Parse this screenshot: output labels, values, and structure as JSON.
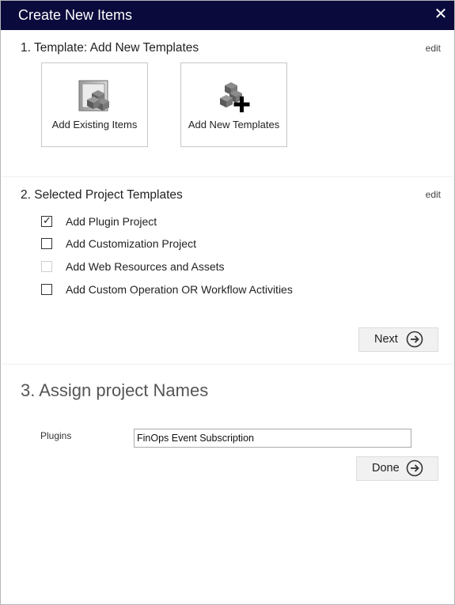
{
  "window": {
    "title": "Create New Items",
    "close_glyph": "✕"
  },
  "section1": {
    "title": "1. Template: Add New Templates",
    "edit_label": "edit",
    "tiles": [
      {
        "label": "Add Existing Items",
        "icon": "existing-items-icon"
      },
      {
        "label": "Add New Templates",
        "icon": "new-templates-icon"
      }
    ]
  },
  "section2": {
    "title": "2. Selected Project Templates",
    "edit_label": "edit",
    "options": [
      {
        "label": "Add Plugin Project",
        "checked": true,
        "enabled": true
      },
      {
        "label": "Add Customization Project",
        "checked": false,
        "enabled": true
      },
      {
        "label": "Add Web Resources and Assets",
        "checked": false,
        "enabled": false
      },
      {
        "label": "Add Custom Operation OR Workflow Activities",
        "checked": false,
        "enabled": true
      }
    ],
    "next_label": "Next"
  },
  "section3": {
    "title": "3. Assign project Names",
    "field_label": "Plugins",
    "field_value": "FinOps Event Subscription",
    "done_label": "Done"
  }
}
